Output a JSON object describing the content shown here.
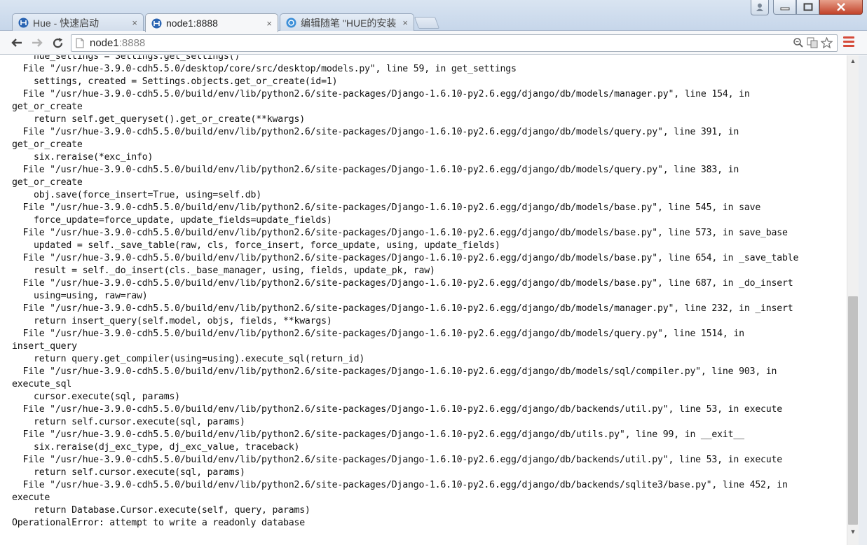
{
  "tabs": [
    {
      "label": "Hue - 快速启动",
      "icon": "hue-favicon",
      "active": false
    },
    {
      "label": "node1:8888",
      "icon": "hue-favicon",
      "active": true
    },
    {
      "label": "编辑随笔 \"HUE的安装",
      "icon": "cnblogs-favicon",
      "active": false
    }
  ],
  "tab_close_glyph": "×",
  "address_bar": {
    "host": "node1",
    "port": ":8888"
  },
  "traceback_lines": [
    "    hue_settings = Settings.get_settings()",
    "  File \"/usr/hue-3.9.0-cdh5.5.0/desktop/core/src/desktop/models.py\", line 59, in get_settings",
    "    settings, created = Settings.objects.get_or_create(id=1)",
    "  File \"/usr/hue-3.9.0-cdh5.5.0/build/env/lib/python2.6/site-packages/Django-1.6.10-py2.6.egg/django/db/models/manager.py\", line 154, in",
    "get_or_create",
    "    return self.get_queryset().get_or_create(**kwargs)",
    "  File \"/usr/hue-3.9.0-cdh5.5.0/build/env/lib/python2.6/site-packages/Django-1.6.10-py2.6.egg/django/db/models/query.py\", line 391, in",
    "get_or_create",
    "    six.reraise(*exc_info)",
    "  File \"/usr/hue-3.9.0-cdh5.5.0/build/env/lib/python2.6/site-packages/Django-1.6.10-py2.6.egg/django/db/models/query.py\", line 383, in",
    "get_or_create",
    "    obj.save(force_insert=True, using=self.db)",
    "  File \"/usr/hue-3.9.0-cdh5.5.0/build/env/lib/python2.6/site-packages/Django-1.6.10-py2.6.egg/django/db/models/base.py\", line 545, in save",
    "    force_update=force_update, update_fields=update_fields)",
    "  File \"/usr/hue-3.9.0-cdh5.5.0/build/env/lib/python2.6/site-packages/Django-1.6.10-py2.6.egg/django/db/models/base.py\", line 573, in save_base",
    "    updated = self._save_table(raw, cls, force_insert, force_update, using, update_fields)",
    "  File \"/usr/hue-3.9.0-cdh5.5.0/build/env/lib/python2.6/site-packages/Django-1.6.10-py2.6.egg/django/db/models/base.py\", line 654, in _save_table",
    "    result = self._do_insert(cls._base_manager, using, fields, update_pk, raw)",
    "  File \"/usr/hue-3.9.0-cdh5.5.0/build/env/lib/python2.6/site-packages/Django-1.6.10-py2.6.egg/django/db/models/base.py\", line 687, in _do_insert",
    "    using=using, raw=raw)",
    "  File \"/usr/hue-3.9.0-cdh5.5.0/build/env/lib/python2.6/site-packages/Django-1.6.10-py2.6.egg/django/db/models/manager.py\", line 232, in _insert",
    "    return insert_query(self.model, objs, fields, **kwargs)",
    "  File \"/usr/hue-3.9.0-cdh5.5.0/build/env/lib/python2.6/site-packages/Django-1.6.10-py2.6.egg/django/db/models/query.py\", line 1514, in",
    "insert_query",
    "    return query.get_compiler(using=using).execute_sql(return_id)",
    "  File \"/usr/hue-3.9.0-cdh5.5.0/build/env/lib/python2.6/site-packages/Django-1.6.10-py2.6.egg/django/db/models/sql/compiler.py\", line 903, in",
    "execute_sql",
    "    cursor.execute(sql, params)",
    "  File \"/usr/hue-3.9.0-cdh5.5.0/build/env/lib/python2.6/site-packages/Django-1.6.10-py2.6.egg/django/db/backends/util.py\", line 53, in execute",
    "    return self.cursor.execute(sql, params)",
    "  File \"/usr/hue-3.9.0-cdh5.5.0/build/env/lib/python2.6/site-packages/Django-1.6.10-py2.6.egg/django/db/utils.py\", line 99, in __exit__",
    "    six.reraise(dj_exc_type, dj_exc_value, traceback)",
    "  File \"/usr/hue-3.9.0-cdh5.5.0/build/env/lib/python2.6/site-packages/Django-1.6.10-py2.6.egg/django/db/backends/util.py\", line 53, in execute",
    "    return self.cursor.execute(sql, params)",
    "  File \"/usr/hue-3.9.0-cdh5.5.0/build/env/lib/python2.6/site-packages/Django-1.6.10-py2.6.egg/django/db/backends/sqlite3/base.py\", line 452, in",
    "execute",
    "    return Database.Cursor.execute(self, query, params)",
    "OperationalError: attempt to write a readonly database"
  ],
  "colors": {
    "close_button": "#c2432a",
    "menu_icon": "#d54b3a",
    "tab_strip": "#c6d6ea"
  },
  "icons": [
    "back-icon",
    "forward-icon",
    "reload-icon",
    "page-icon",
    "zoom-icon",
    "translate-icon",
    "star-icon",
    "menu-icon",
    "user-icon",
    "minimize-icon",
    "maximize-icon",
    "close-icon"
  ]
}
